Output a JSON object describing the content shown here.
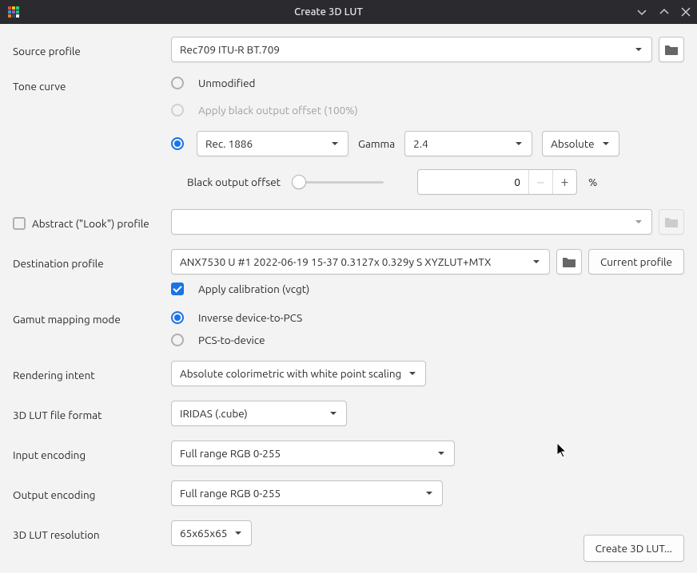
{
  "window": {
    "title": "Create 3D LUT"
  },
  "labels": {
    "source_profile": "Source profile",
    "tone_curve": "Tone curve",
    "abstract_profile": "Abstract (\"Look\") profile",
    "dest_profile": "Destination profile",
    "gamut_mode": "Gamut mapping mode",
    "rendering_intent": "Rendering intent",
    "file_format": "3D LUT file format",
    "input_encoding": "Input encoding",
    "output_encoding": "Output encoding",
    "resolution": "3D LUT resolution"
  },
  "values": {
    "source_profile": "Rec709 ITU-R BT.709",
    "tone_unmodified": "Unmodified",
    "tone_bpoffset": "Apply black output offset (100%)",
    "tone_curve_select": "Rec. 1886",
    "gamma_label": "Gamma",
    "gamma_value": "2.4",
    "gamma_mode": "Absolute",
    "black_offset_label": "Black output offset",
    "black_offset_value": "0",
    "black_offset_unit": "%",
    "dest_profile": "ANX7530 U #1 2022-06-19 15-37 0.3127x 0.329y S XYZLUT+MTX",
    "current_profile_btn": "Current profile",
    "apply_calibration": "Apply calibration (vcgt)",
    "gamut_inverse": "Inverse device-to-PCS",
    "gamut_pcs": "PCS-to-device",
    "rendering_intent": "Absolute colorimetric with white point scaling",
    "file_format": "IRIDAS (.cube)",
    "input_encoding": "Full range RGB 0-255",
    "output_encoding": "Full range RGB 0-255",
    "resolution": "65x65x65",
    "create_btn": "Create 3D LUT..."
  }
}
